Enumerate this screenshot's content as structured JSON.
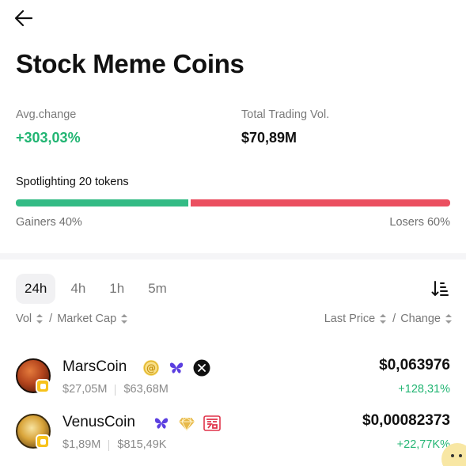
{
  "page": {
    "title": "Stock Meme Coins"
  },
  "stats": {
    "avg_change_label": "Avg.change",
    "avg_change_value": "+303,03%",
    "total_vol_label": "Total Trading Vol.",
    "total_vol_value": "$70,89M"
  },
  "spotlight": {
    "label": "Spotlighting 20 tokens",
    "gainers_label": "Gainers 40%",
    "losers_label": "Losers 60%",
    "gainers_fraction": 0.4,
    "losers_fraction": 0.6
  },
  "tabs": [
    {
      "label": "24h",
      "active": true
    },
    {
      "label": "4h",
      "active": false
    },
    {
      "label": "1h",
      "active": false
    },
    {
      "label": "5m",
      "active": false
    }
  ],
  "columns": {
    "vol": "Vol",
    "market_cap": "Market Cap",
    "last_price": "Last Price",
    "change": "Change",
    "separator": "/"
  },
  "coins": [
    {
      "name": "MarsCoin",
      "volume": "$27,05M",
      "market_cap": "$63,68M",
      "price": "$0,063976",
      "change": "+128,31%",
      "icons": [
        "at-sign-badge-icon",
        "butterfly-icon",
        "x-twitter-icon"
      ]
    },
    {
      "name": "VenusCoin",
      "volume": "$1,89M",
      "market_cap": "$815,49K",
      "price": "$0,00082373",
      "change": "+22,77K%",
      "icons": [
        "butterfly-icon",
        "diamond-icon",
        "red-logo-icon"
      ]
    }
  ],
  "colors": {
    "positive": "#22b573",
    "gainers_bar": "#33bb85",
    "losers_bar": "#eb4f60",
    "text_primary": "#111111",
    "text_secondary": "#7a7a7a"
  }
}
